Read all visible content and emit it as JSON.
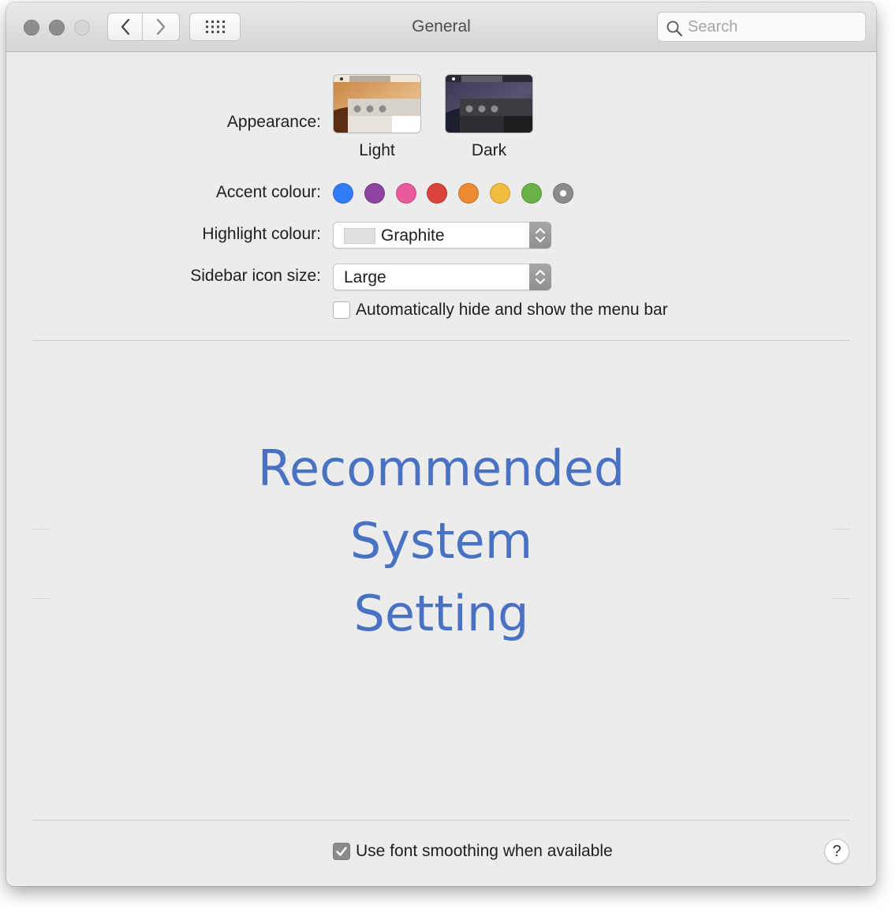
{
  "window": {
    "title": "General",
    "traffic_lights": [
      "close",
      "minimize",
      "zoom"
    ],
    "nav": {
      "back_icon": "chevron-left-icon",
      "forward_icon": "chevron-right-icon",
      "grid_icon": "grid-icon"
    },
    "search": {
      "placeholder": "Search",
      "value": "",
      "icon": "search-icon"
    }
  },
  "appearance": {
    "label": "Appearance:",
    "options": [
      {
        "label": "Light",
        "selected": true
      },
      {
        "label": "Dark",
        "selected": false
      }
    ]
  },
  "accent": {
    "label": "Accent colour:",
    "colors": [
      {
        "name": "blue",
        "hex": "#2f7cf6"
      },
      {
        "name": "purple",
        "hex": "#8e44a0"
      },
      {
        "name": "pink",
        "hex": "#e95b9c"
      },
      {
        "name": "red",
        "hex": "#d9433b"
      },
      {
        "name": "orange",
        "hex": "#ec8b33"
      },
      {
        "name": "yellow",
        "hex": "#f2bd3f"
      },
      {
        "name": "green",
        "hex": "#6ab149"
      },
      {
        "name": "graphite",
        "hex": "#8c8c8c",
        "selected": true
      }
    ]
  },
  "highlight": {
    "label": "Highlight colour:",
    "value": "Graphite",
    "swatch_hex": "#e0e0e0"
  },
  "sidebar_icon_size": {
    "label": "Sidebar icon size:",
    "value": "Large"
  },
  "menu_bar": {
    "label": "Automatically hide and show the menu bar",
    "checked": false
  },
  "overlay": {
    "lines": [
      "Recommended",
      "System",
      "Setting"
    ],
    "color": "#4a72c2"
  },
  "font_smoothing": {
    "label": "Use font smoothing when available",
    "checked": true
  },
  "help": {
    "label": "?"
  }
}
